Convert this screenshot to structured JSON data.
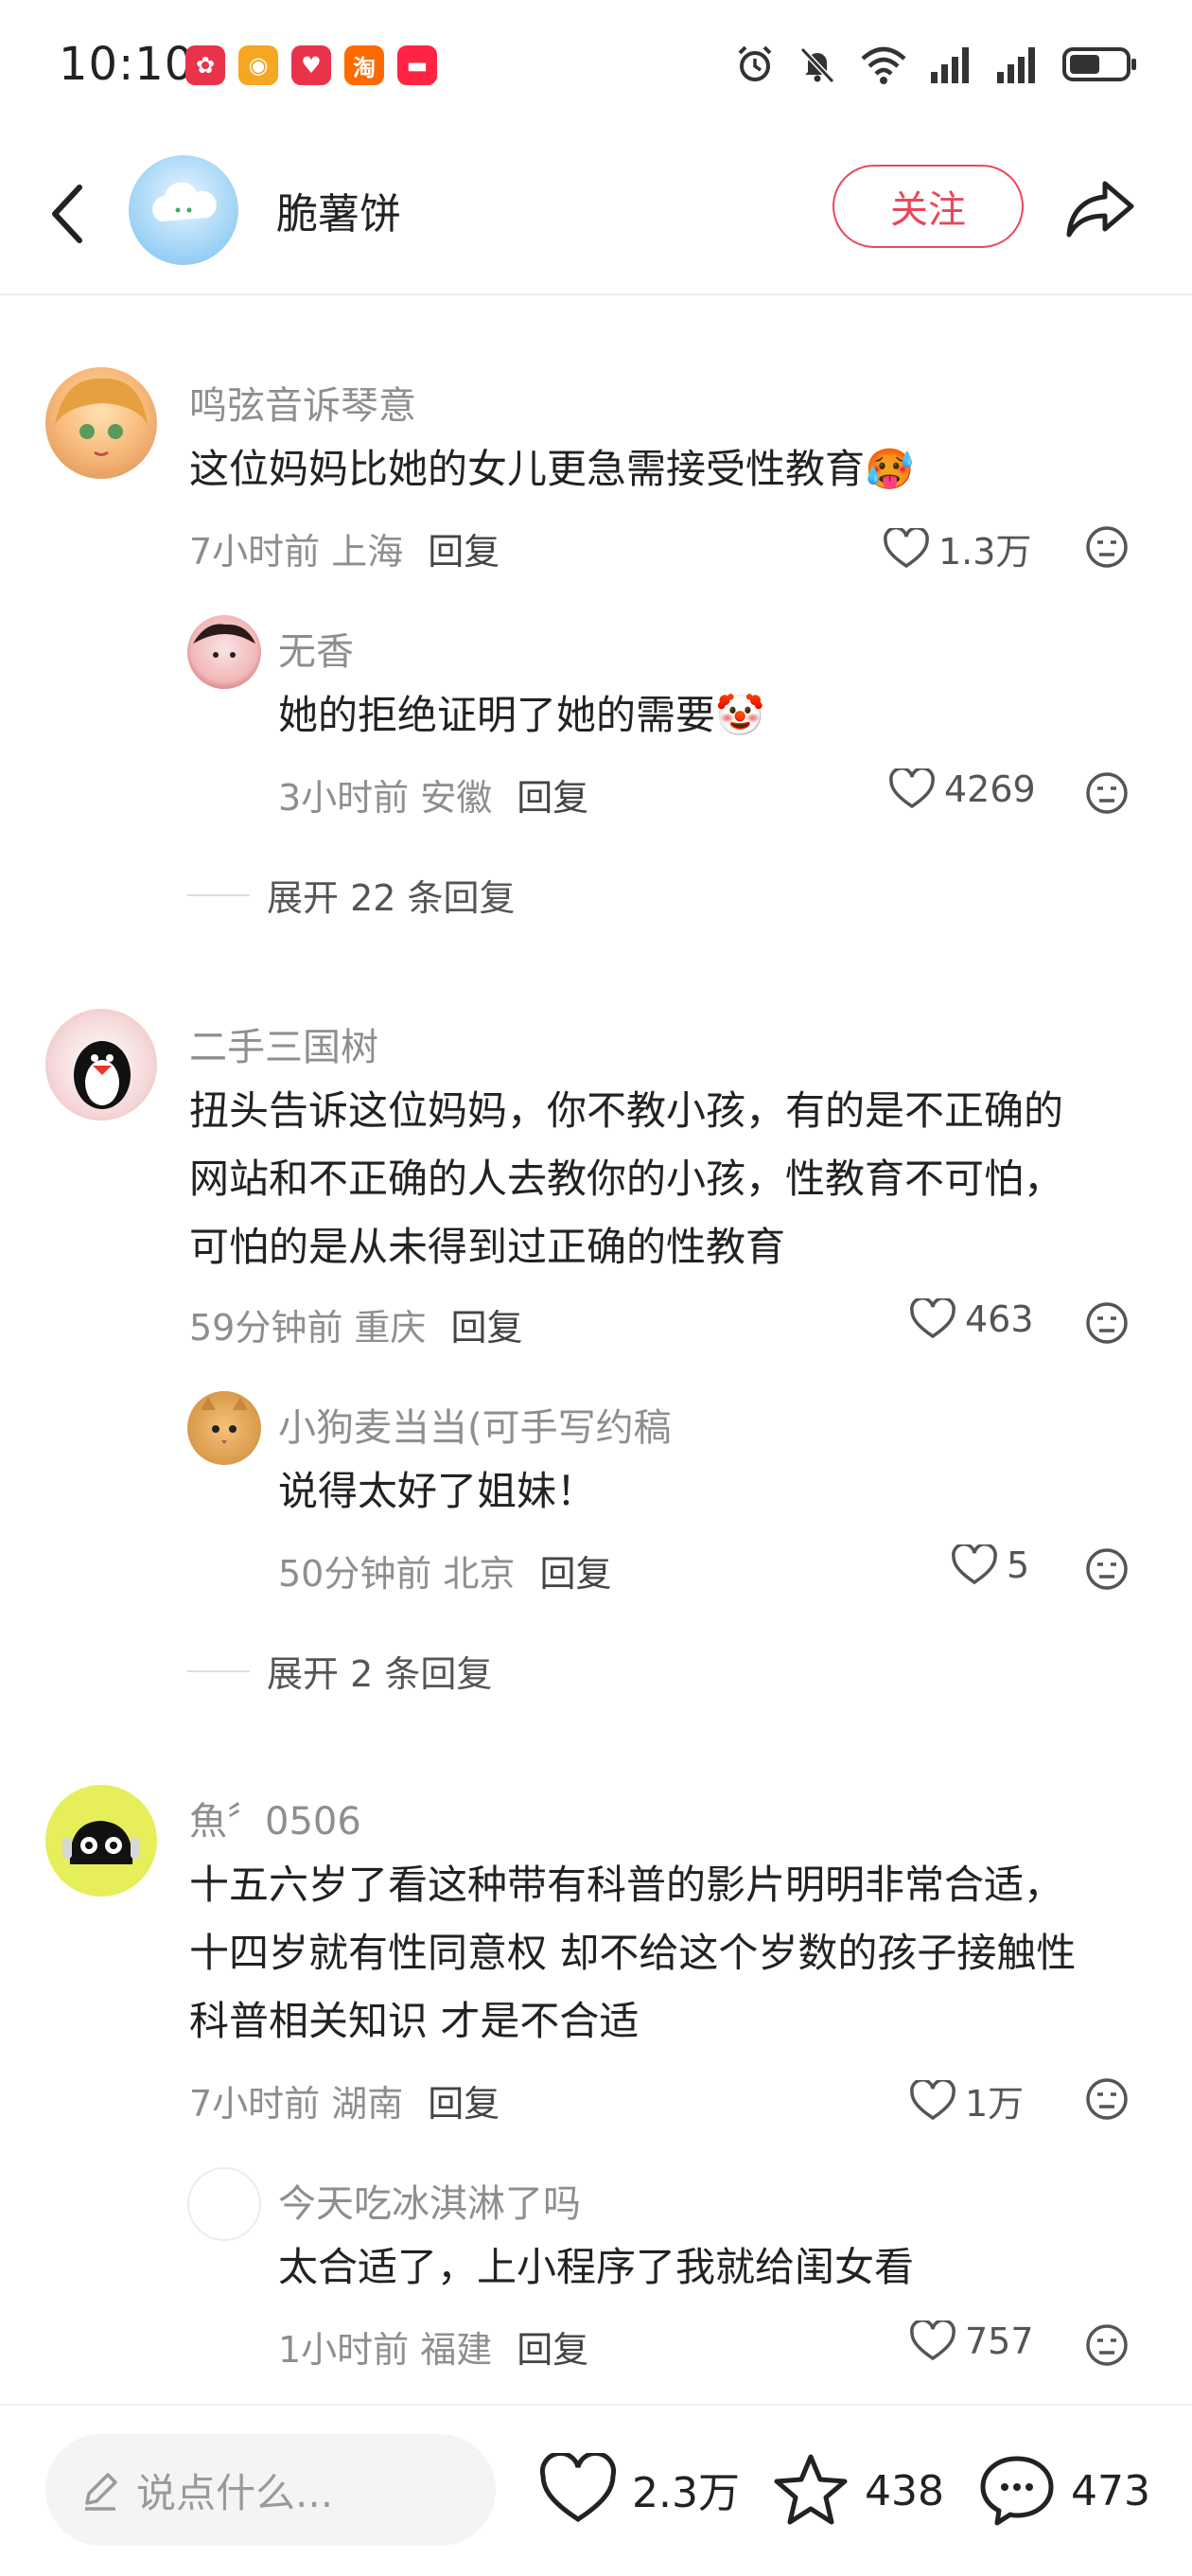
{
  "status_bar": {
    "time": "10:10",
    "app_badges": [
      {
        "name": "app-notification-icon-1",
        "color": "#e8334a",
        "glyph": "✿"
      },
      {
        "name": "weibo-icon",
        "color": "#f5a623",
        "glyph": "◉"
      },
      {
        "name": "app-notification-icon-3",
        "color": "#e8334a",
        "glyph": "♥"
      },
      {
        "name": "taobao-icon",
        "color": "#ff6a00",
        "glyph": "淘"
      },
      {
        "name": "xiaohongshu-icon",
        "color": "#ff2442",
        "glyph": "▬"
      }
    ],
    "battery_level": 0.55
  },
  "header": {
    "author_name": "脆薯饼",
    "follow_label": "关注"
  },
  "comments": [
    {
      "name": "鸣弦音诉琴意",
      "lines": [
        "这位妈妈比她的女儿更急需接受性教育🥵"
      ],
      "time_location": "7小时前 上海",
      "reply_label": "回复",
      "likes": "1.3万",
      "replies": [
        {
          "name": "无香",
          "lines": [
            "她的拒绝证明了她的需要🤡"
          ],
          "time_location": "3小时前 安徽",
          "reply_label": "回复",
          "likes": "4269"
        }
      ],
      "expand_label": "展开 22 条回复"
    },
    {
      "name": "二手三国树",
      "lines": [
        "扭头告诉这位妈妈，你不教小孩，有的是不正确的",
        "网站和不正确的人去教你的小孩，性教育不可怕，",
        "可怕的是从未得到过正确的性教育"
      ],
      "time_location": "59分钟前 重庆",
      "reply_label": "回复",
      "likes": "463",
      "replies": [
        {
          "name": "小狗麦当当(可手写约稿",
          "lines": [
            "说得太好了姐妹！"
          ],
          "time_location": "50分钟前 北京",
          "reply_label": "回复",
          "likes": "5"
        }
      ],
      "expand_label": "展开 2 条回复"
    },
    {
      "name": "魚〞0506",
      "lines": [
        "十五六岁了看这种带有科普的影片明明非常合适，",
        "十四岁就有性同意权 却不给这个岁数的孩子接触性",
        "科普相关知识 才是不合适"
      ],
      "time_location": "7小时前 湖南",
      "reply_label": "回复",
      "likes": "1万",
      "replies": [
        {
          "name": "今天吃冰淇淋了吗",
          "lines": [
            "太合适了，上小程序了我就给闺女看"
          ],
          "time_location": "1小时前 福建",
          "reply_label": "回复",
          "likes": "757"
        }
      ]
    }
  ],
  "bottom_bar": {
    "input_placeholder": "说点什么...",
    "likes": "2.3万",
    "stars": "438",
    "comments": "473"
  }
}
